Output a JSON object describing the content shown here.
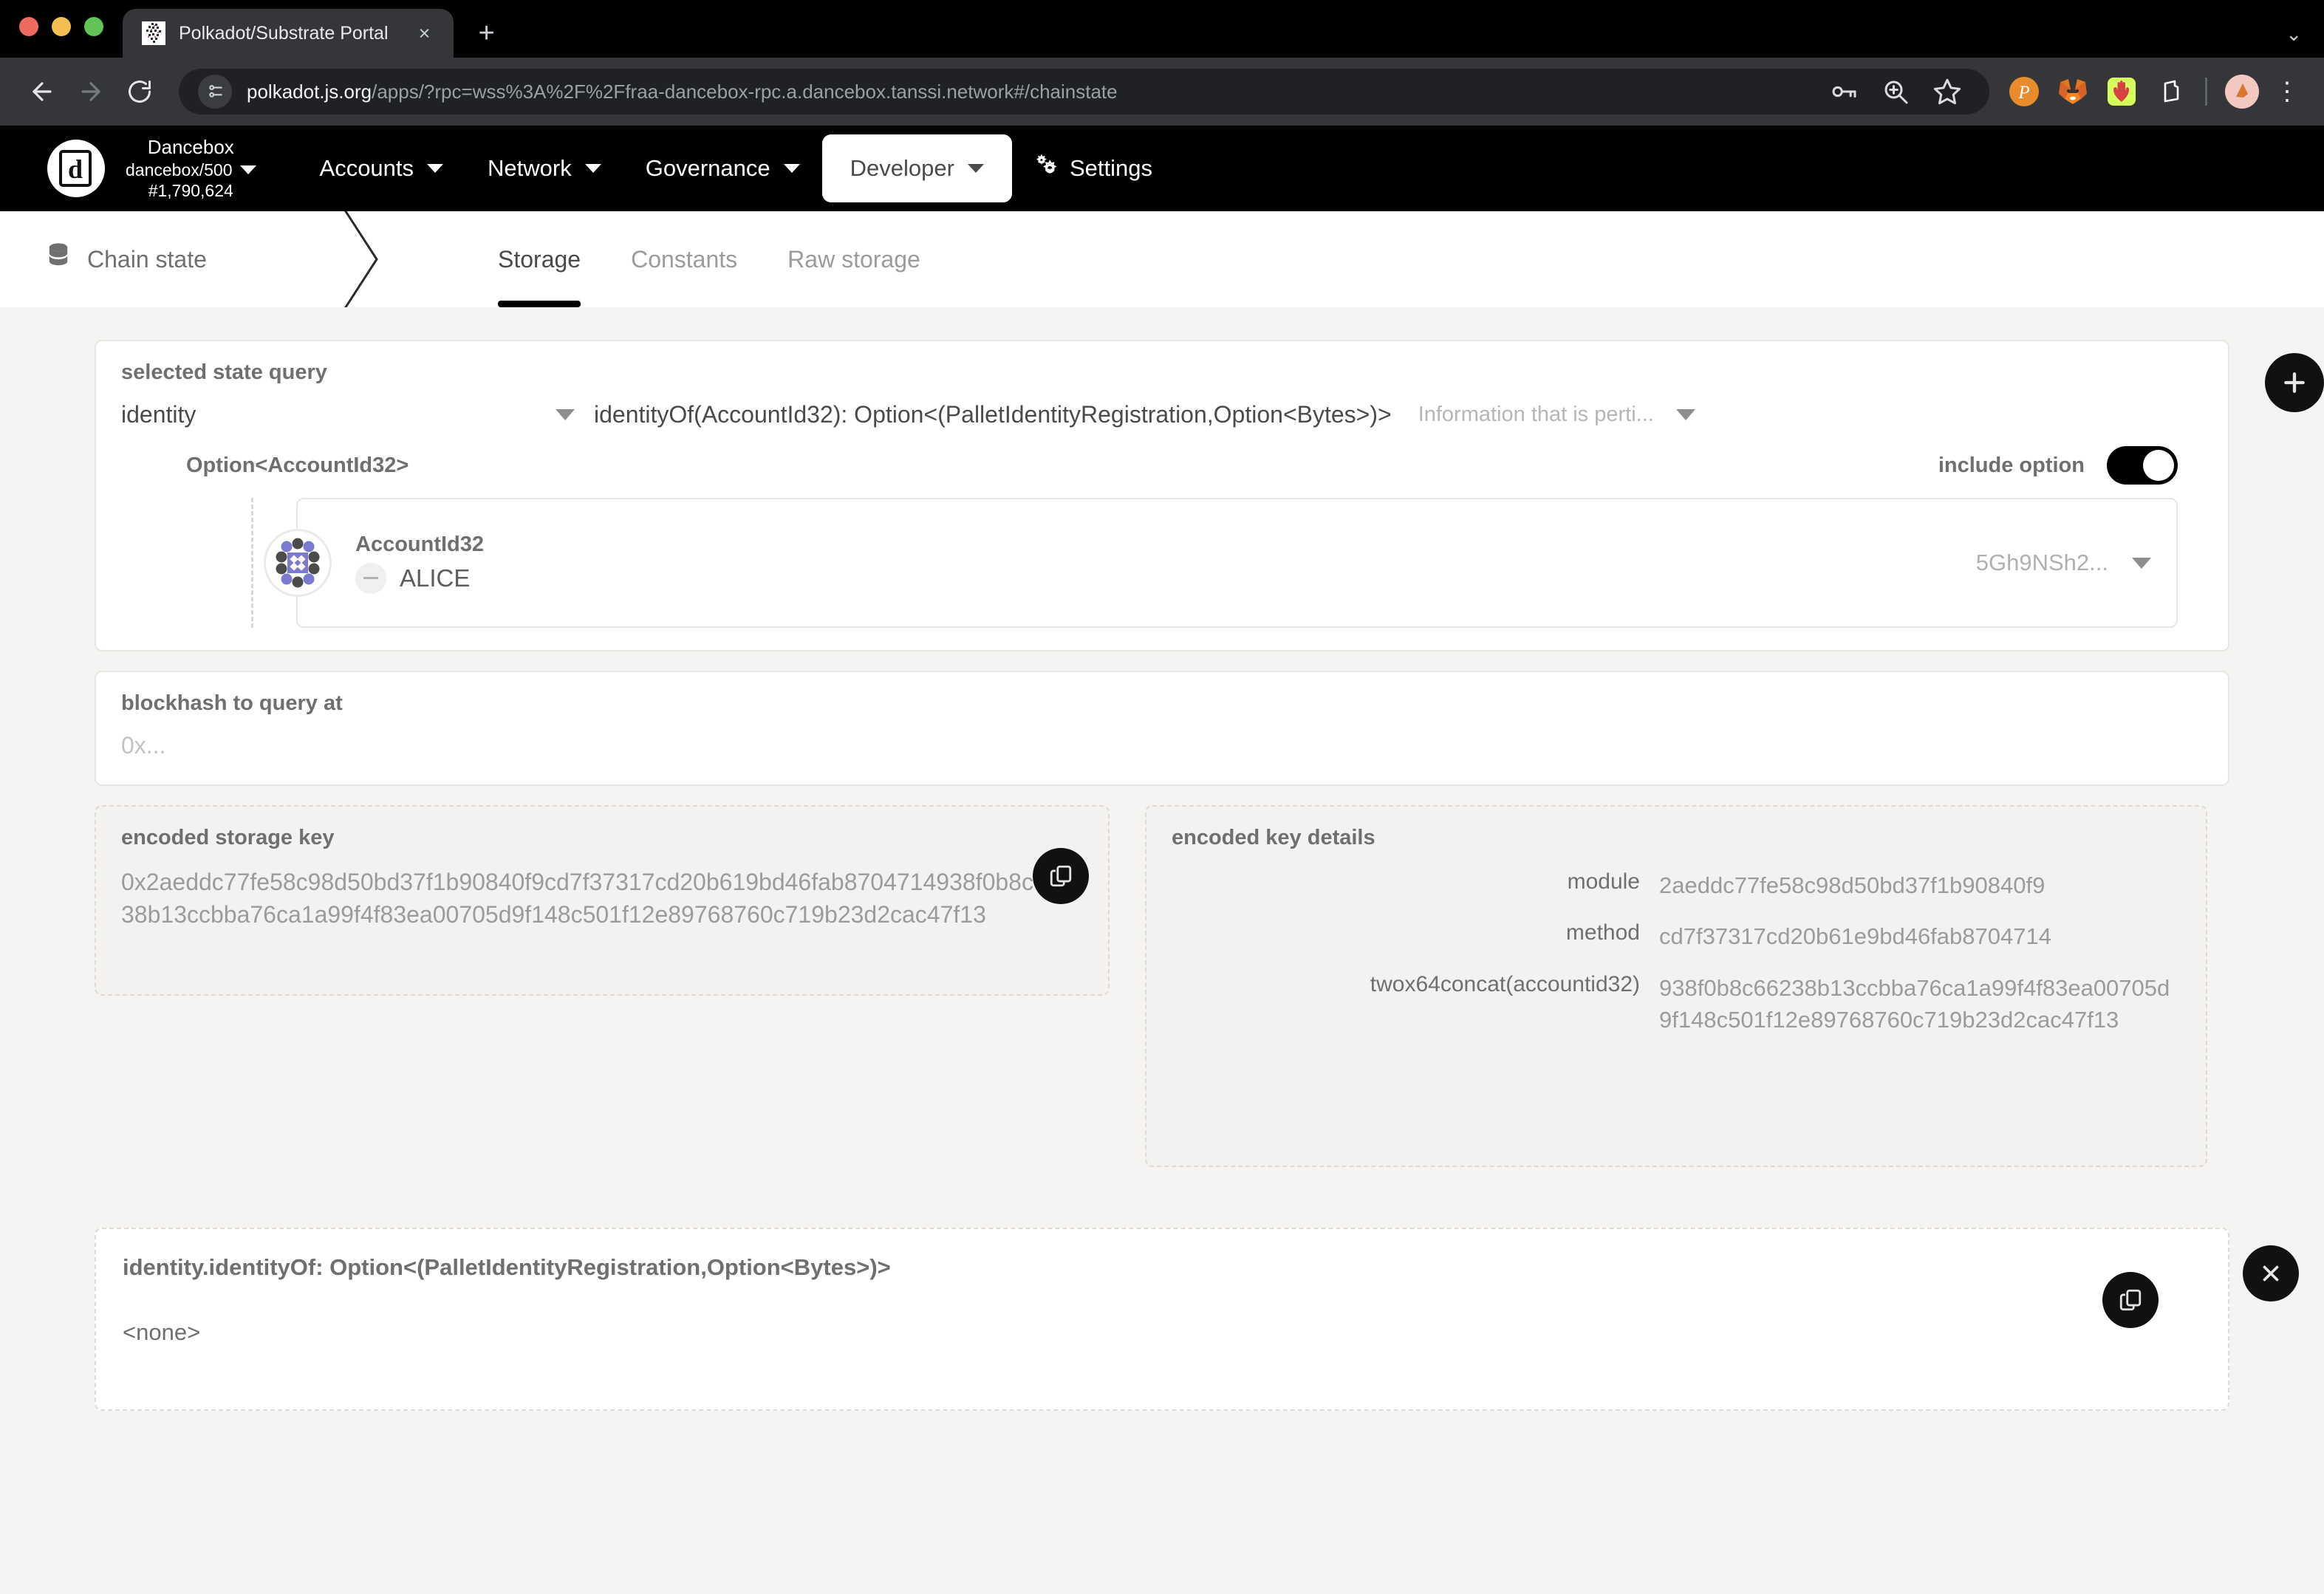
{
  "browser": {
    "tab": {
      "title": "Polkadot/Substrate Portal",
      "close_label": "×",
      "favicon": "polkadot-identicon-favicon"
    },
    "newtab_label": "+",
    "tabstrip_menu_label": "⌄",
    "nav": {
      "back": "back-arrow",
      "forward": "forward-arrow",
      "reload": "reload-arrow"
    },
    "url": {
      "host": "polkadot.js.org",
      "path": "/apps/?rpc=wss%3A%2F%2Ffraa-dancebox-rpc.a.dancebox.tanssi.network#/chainstate",
      "full": "polkadot.js.org/apps/?rpc=wss%3A%2F%2Ffraa-dancebox-rpc.a.dancebox.tanssi.network#/chainstate"
    },
    "omnibox_actions": [
      "key-icon",
      "zoom-in-icon",
      "bookmark-star-icon"
    ],
    "extensions": [
      "polkadot-extension-icon",
      "metamask-fox-icon",
      "talisman-hand-icon",
      "subwallet-icon"
    ],
    "profile": "user-avatar",
    "menu_label": "⋮"
  },
  "appbar": {
    "logo": "dancebox-logo",
    "chain_name": "Dancebox",
    "chain_spec": "dancebox/500",
    "block_number": "#1,790,624",
    "nav_items": [
      {
        "label": "Accounts",
        "has_caret": true,
        "active": false
      },
      {
        "label": "Network",
        "has_caret": true,
        "active": false
      },
      {
        "label": "Governance",
        "has_caret": true,
        "active": false
      },
      {
        "label": "Developer",
        "has_caret": true,
        "active": true
      },
      {
        "label": "Settings",
        "has_caret": false,
        "active": false
      }
    ]
  },
  "breadcrumb": {
    "section": "Chain state",
    "icon": "database-icon",
    "tabs": [
      {
        "label": "Storage",
        "active": true
      },
      {
        "label": "Constants",
        "active": false
      },
      {
        "label": "Raw storage",
        "active": false
      }
    ]
  },
  "query": {
    "label": "selected state query",
    "pallet": "identity",
    "method": "identityOf(AccountId32): Option<(PalletIdentityRegistration,Option<Bytes>)>",
    "doc_summary": "Information that is perti...",
    "add_button": "+"
  },
  "option": {
    "title": "Option<AccountId32>",
    "include_label": "include option",
    "include_on": true
  },
  "account": {
    "type_label": "AccountId32",
    "name": "ALICE",
    "address_short": "5Gh9NSh2...",
    "identicon": "polkadot-identicon",
    "expand_icon": "minus-circle-icon"
  },
  "blockhash": {
    "label": "blockhash to query at",
    "placeholder": "0x...",
    "value": ""
  },
  "encoded_key": {
    "title": "encoded storage key",
    "value": "0x2aeddc77fe58c98d50bd37f1b90840f9cd7f37317cd20b619bd46fab8704714938f0b8c66238b13ccbba76ca1a99f4f83ea00705d9f148c501f12e89768760c719b23d2cac47f13",
    "copy_label": "copy-icon"
  },
  "key_details": {
    "title": "encoded key details",
    "rows": [
      {
        "key": "module",
        "value": "2aeddc77fe58c98d50bd37f1b90840f9"
      },
      {
        "key": "method",
        "value": "cd7f37317cd20b61e9bd46fab8704714"
      },
      {
        "key": "twox64concat(accountid32)",
        "value": "938f0b8c66238b13ccbba76ca1a99f4f83ea00705d9f148c501f12e89768760c719b23d2cac47f13"
      }
    ]
  },
  "result": {
    "title": "identity.identityOf: Option<(PalletIdentityRegistration,Option<Bytes>)>",
    "value": "<none>",
    "copy_label": "copy-icon",
    "close_label": "close-icon"
  },
  "colors": {
    "app_bar_bg": "#000000",
    "page_bg": "#f5f4f2",
    "card_bg": "#ffffff",
    "accent": "#000000",
    "muted_text": "#9b9b9b",
    "identicon_purple": "#7a7ad0",
    "identicon_dark": "#4b4b4b"
  }
}
